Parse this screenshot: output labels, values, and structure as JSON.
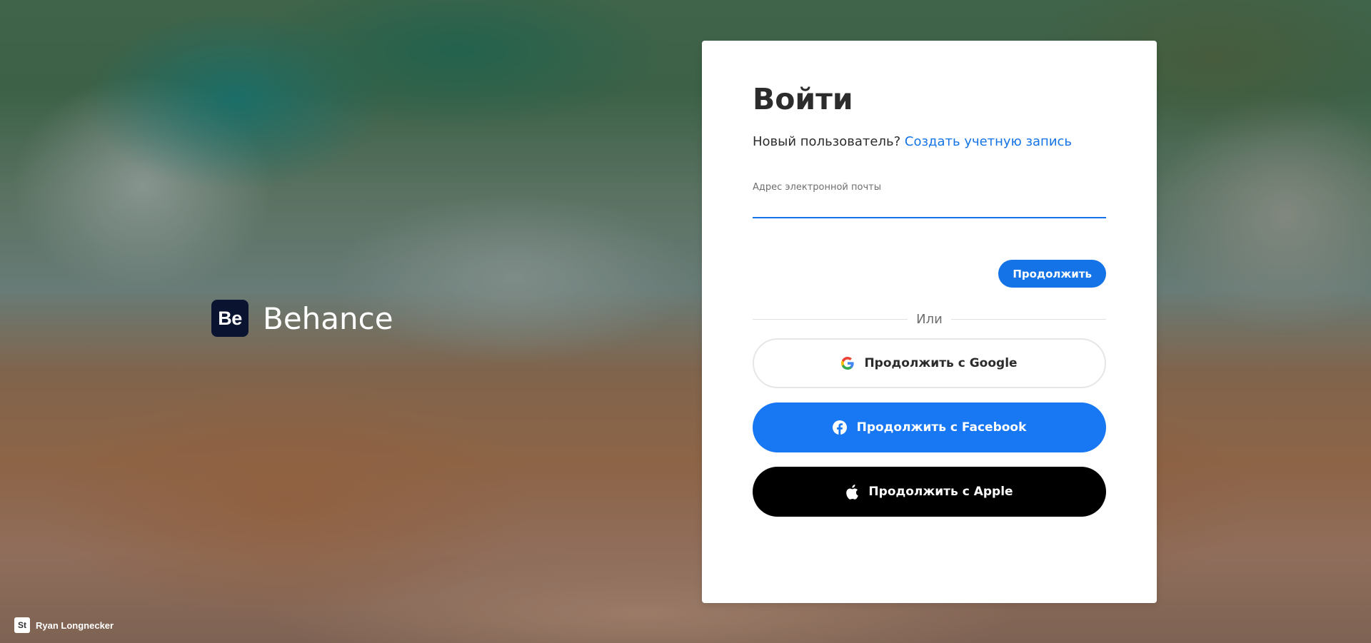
{
  "brand": {
    "logo_text": "Be",
    "name": "Behance"
  },
  "photo_credit": {
    "logo_text": "St",
    "name": "Ryan Longnecker"
  },
  "signin": {
    "title": "Войти",
    "new_user_text": "Новый пользователь?",
    "create_account_link": "Создать учетную запись",
    "email_label": "Адрес электронной почты",
    "email_value": "",
    "continue_button": "Продолжить",
    "divider_text": "Или",
    "google_button": "Продолжить с Google",
    "facebook_button": "Продолжить с Facebook",
    "apple_button": "Продолжить с Apple"
  },
  "colors": {
    "accent": "#1473e6",
    "facebook": "#1877f2",
    "apple": "#000000"
  },
  "icons": {
    "google": "google-icon",
    "facebook": "facebook-icon",
    "apple": "apple-icon"
  }
}
